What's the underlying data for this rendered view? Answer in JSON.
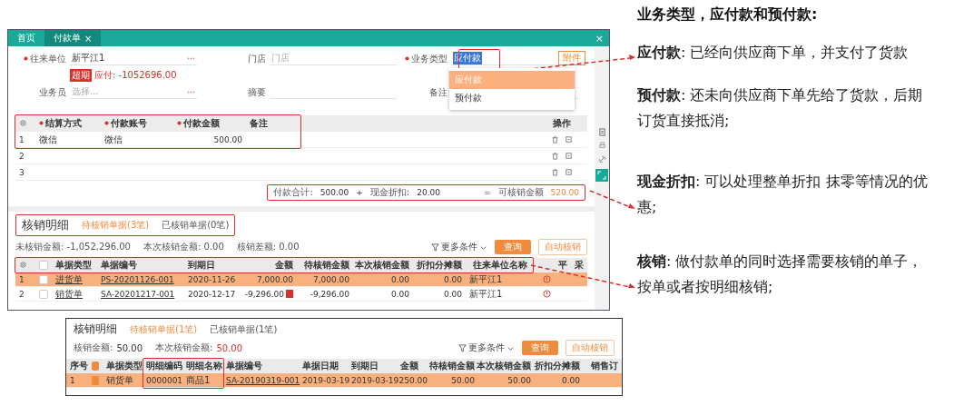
{
  "window": {
    "tabs": [
      {
        "label": "首页",
        "selected": false
      },
      {
        "label": "付款单",
        "selected": true,
        "close": "×"
      }
    ],
    "close": "×"
  },
  "form": {
    "fields": [
      {
        "kind": "input",
        "label": "往来单位",
        "value": "新平江1",
        "required": true,
        "more": true
      },
      {
        "kind": "input",
        "label": "门店",
        "placeholder": "门店"
      },
      {
        "kind": "select",
        "label": "业务类型",
        "value": "应付款",
        "required": true
      },
      {
        "kind": "input",
        "label": "业务员",
        "placeholder": "选择...",
        "more": true
      },
      {
        "kind": "input",
        "label": "摘要"
      },
      {
        "kind": "input",
        "label": "备注"
      }
    ],
    "badge": "超期",
    "payable": "应付: -1052696.00",
    "attach_button": "附件",
    "options": [
      {
        "label": "应付款",
        "selected": true
      },
      {
        "label": "预付款",
        "selected": false
      }
    ]
  },
  "payments": {
    "columns": [
      {
        "label": "结算方式",
        "required": true
      },
      {
        "label": "付款账号",
        "required": true
      },
      {
        "label": "付款金额",
        "required": true
      },
      {
        "label": "备注",
        "required": false
      }
    ],
    "actions_label": "操作",
    "rows": [
      {
        "no": "1",
        "method": "微信",
        "account": "微信",
        "amount": "500.00"
      },
      {
        "no": "2"
      },
      {
        "no": "3"
      }
    ]
  },
  "totals": {
    "paid_label": "付款合计:",
    "paid": "500.00",
    "plus": "+",
    "discount_label": "现金折扣:",
    "discount": "20.00",
    "equals": "=",
    "total_label": "可核销金额",
    "total": "520.00"
  },
  "writeoff": {
    "title": "核销明细",
    "tabs": [
      {
        "label": "待核销单据(3笔)",
        "selected": true
      },
      {
        "label": "已核销单据(0笔)",
        "selected": false
      }
    ],
    "summary": [
      "未核销金额: -1,052,296.00",
      "本次核销金额: 0.00",
      "核销差额: 0.00"
    ],
    "more_filters": "更多条件",
    "query_button": "查询",
    "auto_button": "自动核销",
    "header_checked": false,
    "columns": [
      "单据类型",
      "单据编号",
      "到期日",
      "金额",
      "待核销金额",
      "本次核销金额",
      "折扣分摊额",
      "往来单位名称",
      "平",
      "采"
    ],
    "rows": [
      {
        "no": "1",
        "checked": false,
        "selected": true,
        "type": "进货单",
        "number": "PS-20201126-001",
        "due": "2020-11-26",
        "amount": "7,000.00",
        "flagged": false,
        "pending": "7,000.00",
        "current": "0.00",
        "discount": "0.00",
        "partner": "新平江1"
      },
      {
        "no": "2",
        "checked": false,
        "selected": false,
        "type": "销货单",
        "number": "SA-20201217-001",
        "due": "2020-12-17",
        "amount": "-9,296.00",
        "flagged": true,
        "pending": "-9,296.00",
        "current": "0.00",
        "discount": "0.00",
        "partner": "新平江1"
      }
    ]
  },
  "detail": {
    "title": "核销明细",
    "tabs": [
      {
        "label": "待核销单据(1笔)",
        "selected": true
      },
      {
        "label": "已核销单据(1笔)",
        "selected": false
      }
    ],
    "summary": [
      {
        "label": "核销金额:",
        "value": "50.00"
      },
      {
        "label": "本次核销金额:",
        "value": "50.00"
      }
    ],
    "more_filters": "更多条件",
    "query_button": "查询",
    "auto_button": "自动核销",
    "header_checked": true,
    "columns": [
      "序号",
      "单据类型",
      "明细编码",
      "明细名称",
      "单据编号",
      "单据日期",
      "到期日",
      "金额",
      "待核销金额",
      "本次核销金额",
      "折扣分摊额",
      "销售订"
    ],
    "rows": [
      {
        "no": "1",
        "checked": true,
        "selected": true,
        "type": "销货单",
        "code": "0000001",
        "name": "商品1",
        "number": "SA-20190319-001",
        "date": "2019-03-19",
        "due": "2019-03-19",
        "amount": "250.00",
        "pending": "50.00",
        "current": "50.00",
        "discount": "0.00"
      }
    ]
  },
  "notes": {
    "heading": "业务类型，应付款和预付款:",
    "paragraphs": [
      "**应付款**: 已经向供应商下单，并支付了货款",
      "**预付款**: 还未向供应商下单先给了货款，后期订货直接抵消;",
      "**现金折扣**: 可以处理整单折扣 抹零等情况的优惠;",
      "**核销**: 做付款单的同时选择需要核销的单子，按单或者按明细核销;"
    ]
  }
}
